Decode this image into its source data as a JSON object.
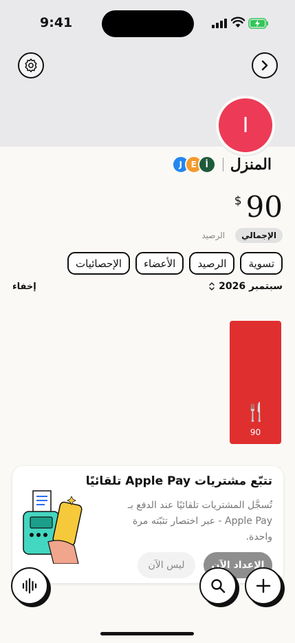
{
  "status_bar": {
    "time": "9:41"
  },
  "profile": {
    "initial": "I",
    "color": "#ec3a57"
  },
  "group": {
    "name": "المنزل",
    "members": [
      {
        "initial": "أ",
        "color": "#1e5a3b"
      },
      {
        "initial": "E",
        "color": "#f39a2b"
      },
      {
        "initial": "J",
        "color": "#2386f0"
      }
    ]
  },
  "balance": {
    "currency": "$",
    "amount": "90"
  },
  "view_toggle": {
    "active": "الإجمالي",
    "inactive": "الرصيد"
  },
  "tabs": [
    "تسوية",
    "الرصيد",
    "الأعضاء",
    "الإحصائيات"
  ],
  "period": {
    "label": "سبتمبر 2026",
    "hide": "إخفاء"
  },
  "chart_data": {
    "type": "bar",
    "categories": [
      "🍴"
    ],
    "values": [
      90
    ],
    "bar_color": "#e02f2f"
  },
  "promo": {
    "title": "تتبّع مشتريات Apple Pay تلقائيًا",
    "body": "تُسجَّل المشتريات تلقائيًا عند الدفع بـ Apple Pay - عبر اختصار تثبّته مرة واحدة.",
    "primary": "الإعداد الآن",
    "secondary": "ليس الآن"
  }
}
